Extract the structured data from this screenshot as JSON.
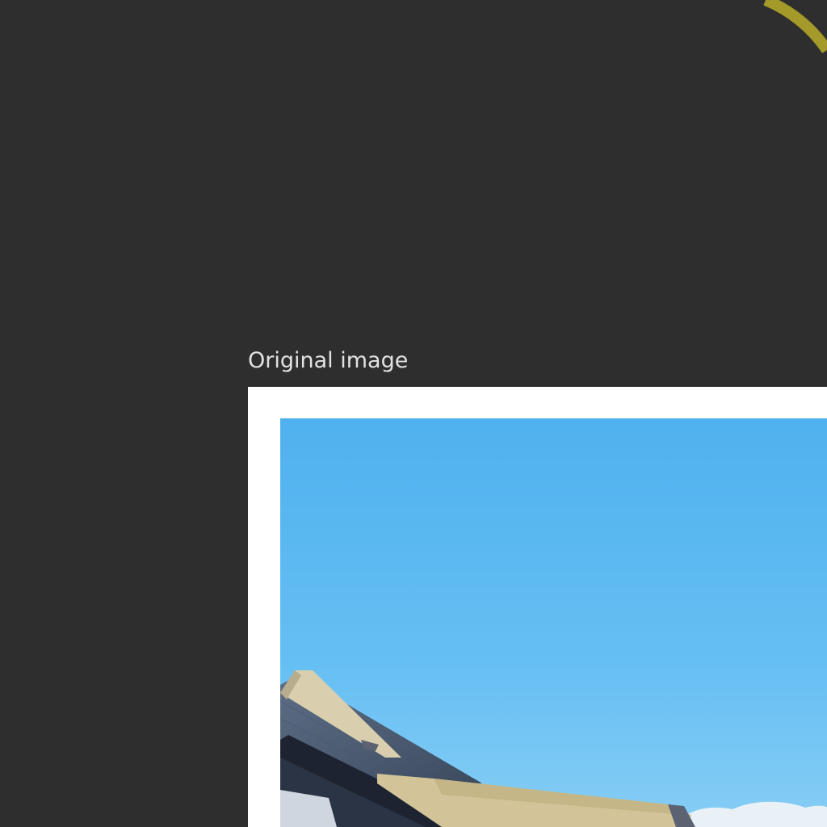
{
  "section": {
    "label": "Original image"
  },
  "photo": {
    "description_icon": "photo-house-roof-blue-sky"
  },
  "colors": {
    "background": "#2e2e2e",
    "accent": "#a39a2a",
    "label_text": "#e2e2e2",
    "frame": "#ffffff"
  }
}
